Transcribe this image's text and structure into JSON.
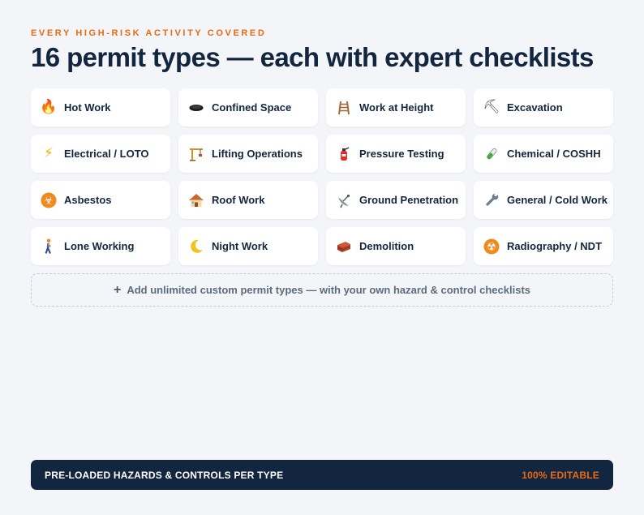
{
  "header": {
    "eyebrow": "EVERY HIGH-RISK ACTIVITY COVERED",
    "title": "16 permit types — each with expert checklists"
  },
  "permits": [
    {
      "label": "Hot Work",
      "icon": "fire-icon",
      "glyph": "🔥",
      "color": "#f0541e"
    },
    {
      "label": "Confined Space",
      "icon": "manhole-icon",
      "glyph": "",
      "color": "#1a1a1a"
    },
    {
      "label": "Work at Height",
      "icon": "ladder-icon",
      "glyph": "🪜",
      "color": "#a4683a"
    },
    {
      "label": "Excavation",
      "icon": "pick-icon",
      "glyph": "⛏",
      "color": "#5a5a5a"
    },
    {
      "label": "Electrical / LOTO",
      "icon": "lightning-icon",
      "glyph": "⚡",
      "color": "#f5b800"
    },
    {
      "label": "Lifting Operations",
      "icon": "crane-icon",
      "glyph": "🏗",
      "color": "#d4912a"
    },
    {
      "label": "Pressure Testing",
      "icon": "fire-extinguisher-icon",
      "glyph": "🧯",
      "color": "#d9302c"
    },
    {
      "label": "Chemical / COSHH",
      "icon": "test-tube-icon",
      "glyph": "🧪",
      "color": "#3fae3b"
    },
    {
      "label": "Asbestos",
      "icon": "biohazard-icon",
      "glyph": "☣",
      "color": "#f08a1c"
    },
    {
      "label": "Roof Work",
      "icon": "house-icon",
      "glyph": "🏠",
      "color": "#c9672d"
    },
    {
      "label": "Ground Penetration",
      "icon": "satellite-dish-icon",
      "glyph": "📡",
      "color": "#6b7785"
    },
    {
      "label": "General / Cold Work",
      "icon": "wrench-icon",
      "glyph": "🔧",
      "color": "#6f7b8b"
    },
    {
      "label": "Lone Working",
      "icon": "person-walking-icon",
      "glyph": "🚶",
      "color": "#e58b2c"
    },
    {
      "label": "Night Work",
      "icon": "crescent-moon-icon",
      "glyph": "🌙",
      "color": "#f3c220"
    },
    {
      "label": "Demolition",
      "icon": "bricks-icon",
      "glyph": "🧱",
      "color": "#b4442c"
    },
    {
      "label": "Radiography / NDT",
      "icon": "radioactive-icon",
      "glyph": "☢",
      "color": "#f08a1c"
    }
  ],
  "add_custom": {
    "plus": "+",
    "label": "Add unlimited custom permit types — with your own hazard & control checklists"
  },
  "footer": {
    "left": "PRE-LOADED HAZARDS & CONTROLS PER TYPE",
    "right": "100% EDITABLE"
  }
}
